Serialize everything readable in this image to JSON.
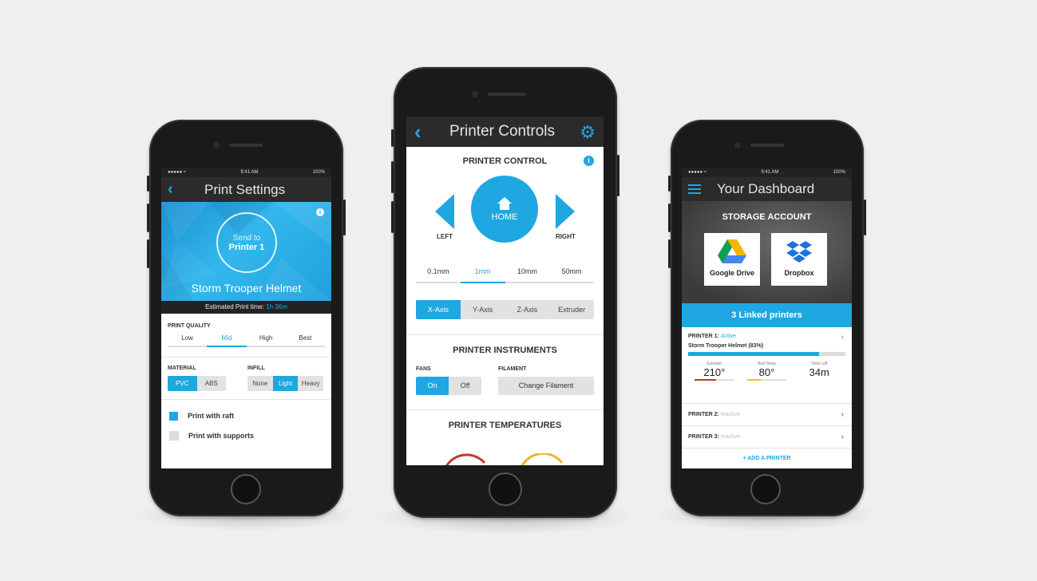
{
  "phone1": {
    "status": {
      "carrier": "●●●●● ≈",
      "time": "9:41 AM",
      "battery": "100%"
    },
    "nav_title": "Print Settings",
    "hero": {
      "send_line1": "Send to",
      "send_line2": "Printer 1",
      "model_name": "Storm Trooper Helmet"
    },
    "estimate": {
      "label": "Estimated Print time:",
      "value": "1h 36m"
    },
    "quality": {
      "label": "PRINT QUALITY",
      "options": [
        "Low",
        "Mid",
        "High",
        "Best"
      ],
      "selected": "Mid"
    },
    "material": {
      "label": "MATERIAL",
      "options": [
        "PVC",
        "ABS"
      ],
      "selected": "PVC"
    },
    "infill": {
      "label": "INFILL",
      "options": [
        "None",
        "Light",
        "Heavy"
      ],
      "selected": "Light"
    },
    "checks": [
      {
        "label": "Print with raft",
        "checked": true
      },
      {
        "label": "Print with supports",
        "checked": false
      }
    ]
  },
  "phone2": {
    "nav_title": "Printer Controls",
    "control": {
      "title": "PRINTER CONTROL",
      "left": "LEFT",
      "right": "RIGHT",
      "home": "HOME"
    },
    "steps": {
      "options": [
        "0.1mm",
        "1mm",
        "10mm",
        "50mm"
      ],
      "selected": "1mm"
    },
    "axes": {
      "options": [
        "X-Axis",
        "Y-Axis",
        "Z-Axis",
        "Extruder"
      ],
      "selected": "X-Axis"
    },
    "instruments": {
      "title": "PRINTER INSTRUMENTS",
      "fans_label": "FANS",
      "fans_options": [
        "On",
        "Off"
      ],
      "fans_selected": "On",
      "filament_label": "FILAMENT",
      "filament_button": "Change Filament"
    },
    "temperatures": {
      "title": "PRINTER TEMPERATURES"
    }
  },
  "phone3": {
    "status": {
      "carrier": "●●●●● ≈",
      "time": "9:41 AM",
      "battery": "100%"
    },
    "nav_title": "Your Dashboard",
    "storage": {
      "title": "STORAGE ACCOUNT",
      "google": "Google Drive",
      "dropbox": "Dropbox"
    },
    "linked": "3 Linked printers",
    "printer1": {
      "name": "PRINTER 1:",
      "status": "Active",
      "job": "Storm Trooper Helmet (83%)",
      "progress": 0.83,
      "stats": [
        {
          "label": "Extruder",
          "value": "210°",
          "color": "#c0392b"
        },
        {
          "label": "Bed Temp",
          "value": "80°",
          "color": "#f1c40f"
        },
        {
          "label": "Time Left",
          "value": "34m",
          "color": ""
        }
      ]
    },
    "printer2": {
      "name": "PRINTER 2:",
      "status": "Inactive"
    },
    "printer3": {
      "name": "PRINTER 3:",
      "status": "Inactive"
    },
    "add": "+ ADD A PRINTER"
  },
  "colors": {
    "accent": "#1ea7e1",
    "dark": "#2b2b2b"
  }
}
